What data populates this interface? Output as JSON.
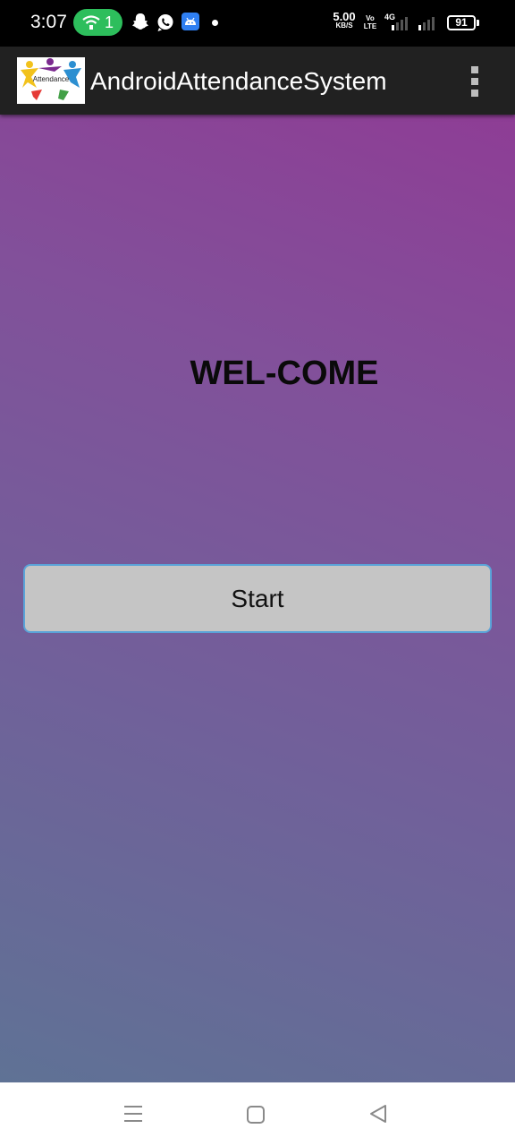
{
  "status_bar": {
    "time": "3:07",
    "hotspot_count": "1",
    "net_speed_value": "5.00",
    "net_speed_unit": "KB/S",
    "volte_line1": "Vo",
    "volte_line2": "LTE",
    "network_type": "4G",
    "battery_level": "91",
    "icons": [
      "hotspot-icon",
      "snapchat-icon",
      "whatsapp-icon",
      "android-icon",
      "notification-dot",
      "signal-icon",
      "battery-icon"
    ]
  },
  "action_bar": {
    "title": "AndroidAttendanceSystem",
    "logo_text": "Attendance",
    "overflow_icon": "more-vert-icon",
    "background": "#212121"
  },
  "main": {
    "heading": "WEL-COME",
    "start_button_label": "Start",
    "gradient_colors": [
      "#8e3d95",
      "#81519a",
      "#71609a",
      "#5f7295"
    ],
    "button_border_color": "#5aa3d8"
  },
  "nav_bar": {
    "icons": [
      "menu-icon",
      "home-icon",
      "back-icon"
    ]
  }
}
